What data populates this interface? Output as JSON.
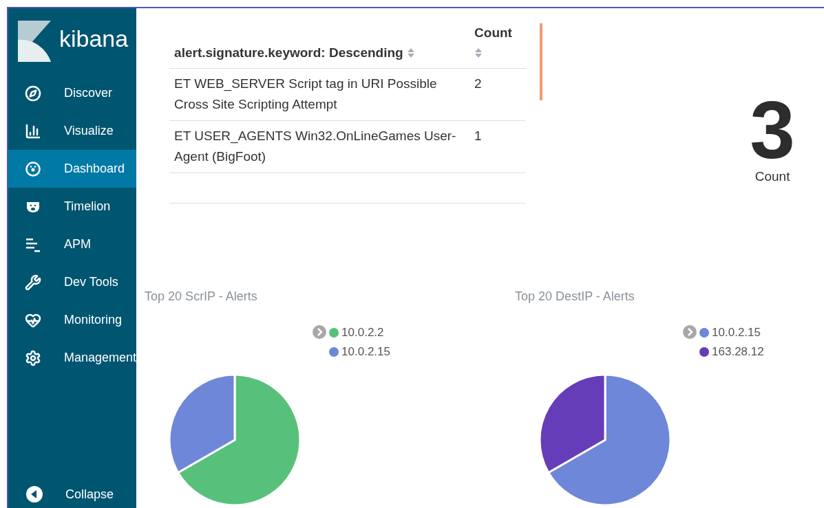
{
  "sidebar": {
    "brand": "kibana",
    "items": [
      {
        "label": "Discover",
        "kind": "compass",
        "selected": false
      },
      {
        "label": "Visualize",
        "kind": "bars",
        "selected": false
      },
      {
        "label": "Dashboard",
        "kind": "dashboard",
        "selected": true
      },
      {
        "label": "Timelion",
        "kind": "bear",
        "selected": false
      },
      {
        "label": "APM",
        "kind": "apm",
        "selected": false
      },
      {
        "label": "Dev Tools",
        "kind": "wrench",
        "selected": false
      },
      {
        "label": "Monitoring",
        "kind": "heart",
        "selected": false
      },
      {
        "label": "Management",
        "kind": "gear",
        "selected": false
      }
    ],
    "collapse": "Collapse"
  },
  "table": {
    "columns": [
      "alert.signature.keyword: Descending",
      "Count"
    ],
    "rows": [
      [
        "ET WEB_SERVER Script tag in URI Possible Cross Site Scripting Attempt",
        "2"
      ],
      [
        "ET USER_AGENTS Win32.OnLineGames User-Agent (BigFoot)",
        "1"
      ]
    ]
  },
  "metric": {
    "value": "3",
    "label": "Count"
  },
  "pies": [
    {
      "title": "Top 20 ScrIP - Alerts",
      "legend": [
        {
          "label": "10.0.2.2",
          "color": "#57c17b"
        },
        {
          "label": "10.0.2.15",
          "color": "#6f87d8"
        }
      ]
    },
    {
      "title": "Top 20 DestIP - Alerts",
      "legend": [
        {
          "label": "10.0.2.15",
          "color": "#6f87d8"
        },
        {
          "label": "163.28.12",
          "color": "#663db8"
        }
      ]
    }
  ]
}
